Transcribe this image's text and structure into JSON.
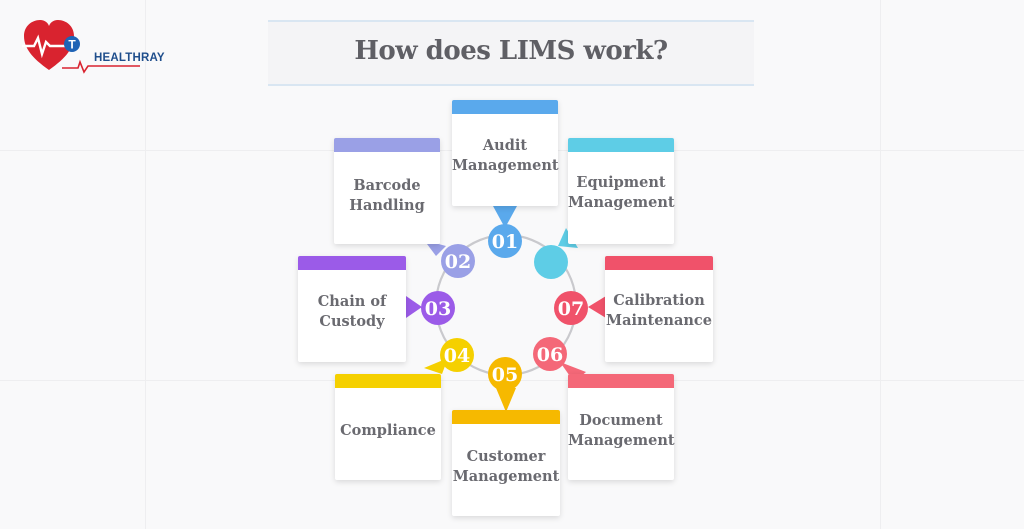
{
  "logo": {
    "text": "HEALTHRAY",
    "emblem_letter": "T"
  },
  "title": "How does LIMS work?",
  "colors": {
    "audit": "#5aa9ec",
    "barcode": "#9aa0e6",
    "custody": "#9b5be8",
    "compliance": "#f5d000",
    "customer": "#f6b900",
    "document": "#f46878",
    "calibration": "#f0526a",
    "equipment": "#5ecde6"
  },
  "steps": [
    {
      "number": "01",
      "line1": "Audit",
      "line2": "Management"
    },
    {
      "number": "02",
      "line1": "Barcode",
      "line2": "Handling"
    },
    {
      "number": "03",
      "line1": "Chain of",
      "line2": "Custody"
    },
    {
      "number": "04",
      "line1": "Compliance",
      "line2": ""
    },
    {
      "number": "05",
      "line1": "Customer",
      "line2": "Management"
    },
    {
      "number": "06",
      "line1": "Document",
      "line2": "Management"
    },
    {
      "number": "07",
      "line1": "Calibration",
      "line2": "Maintenance"
    },
    {
      "number": "",
      "line1": "Equipment",
      "line2": "Management"
    }
  ]
}
